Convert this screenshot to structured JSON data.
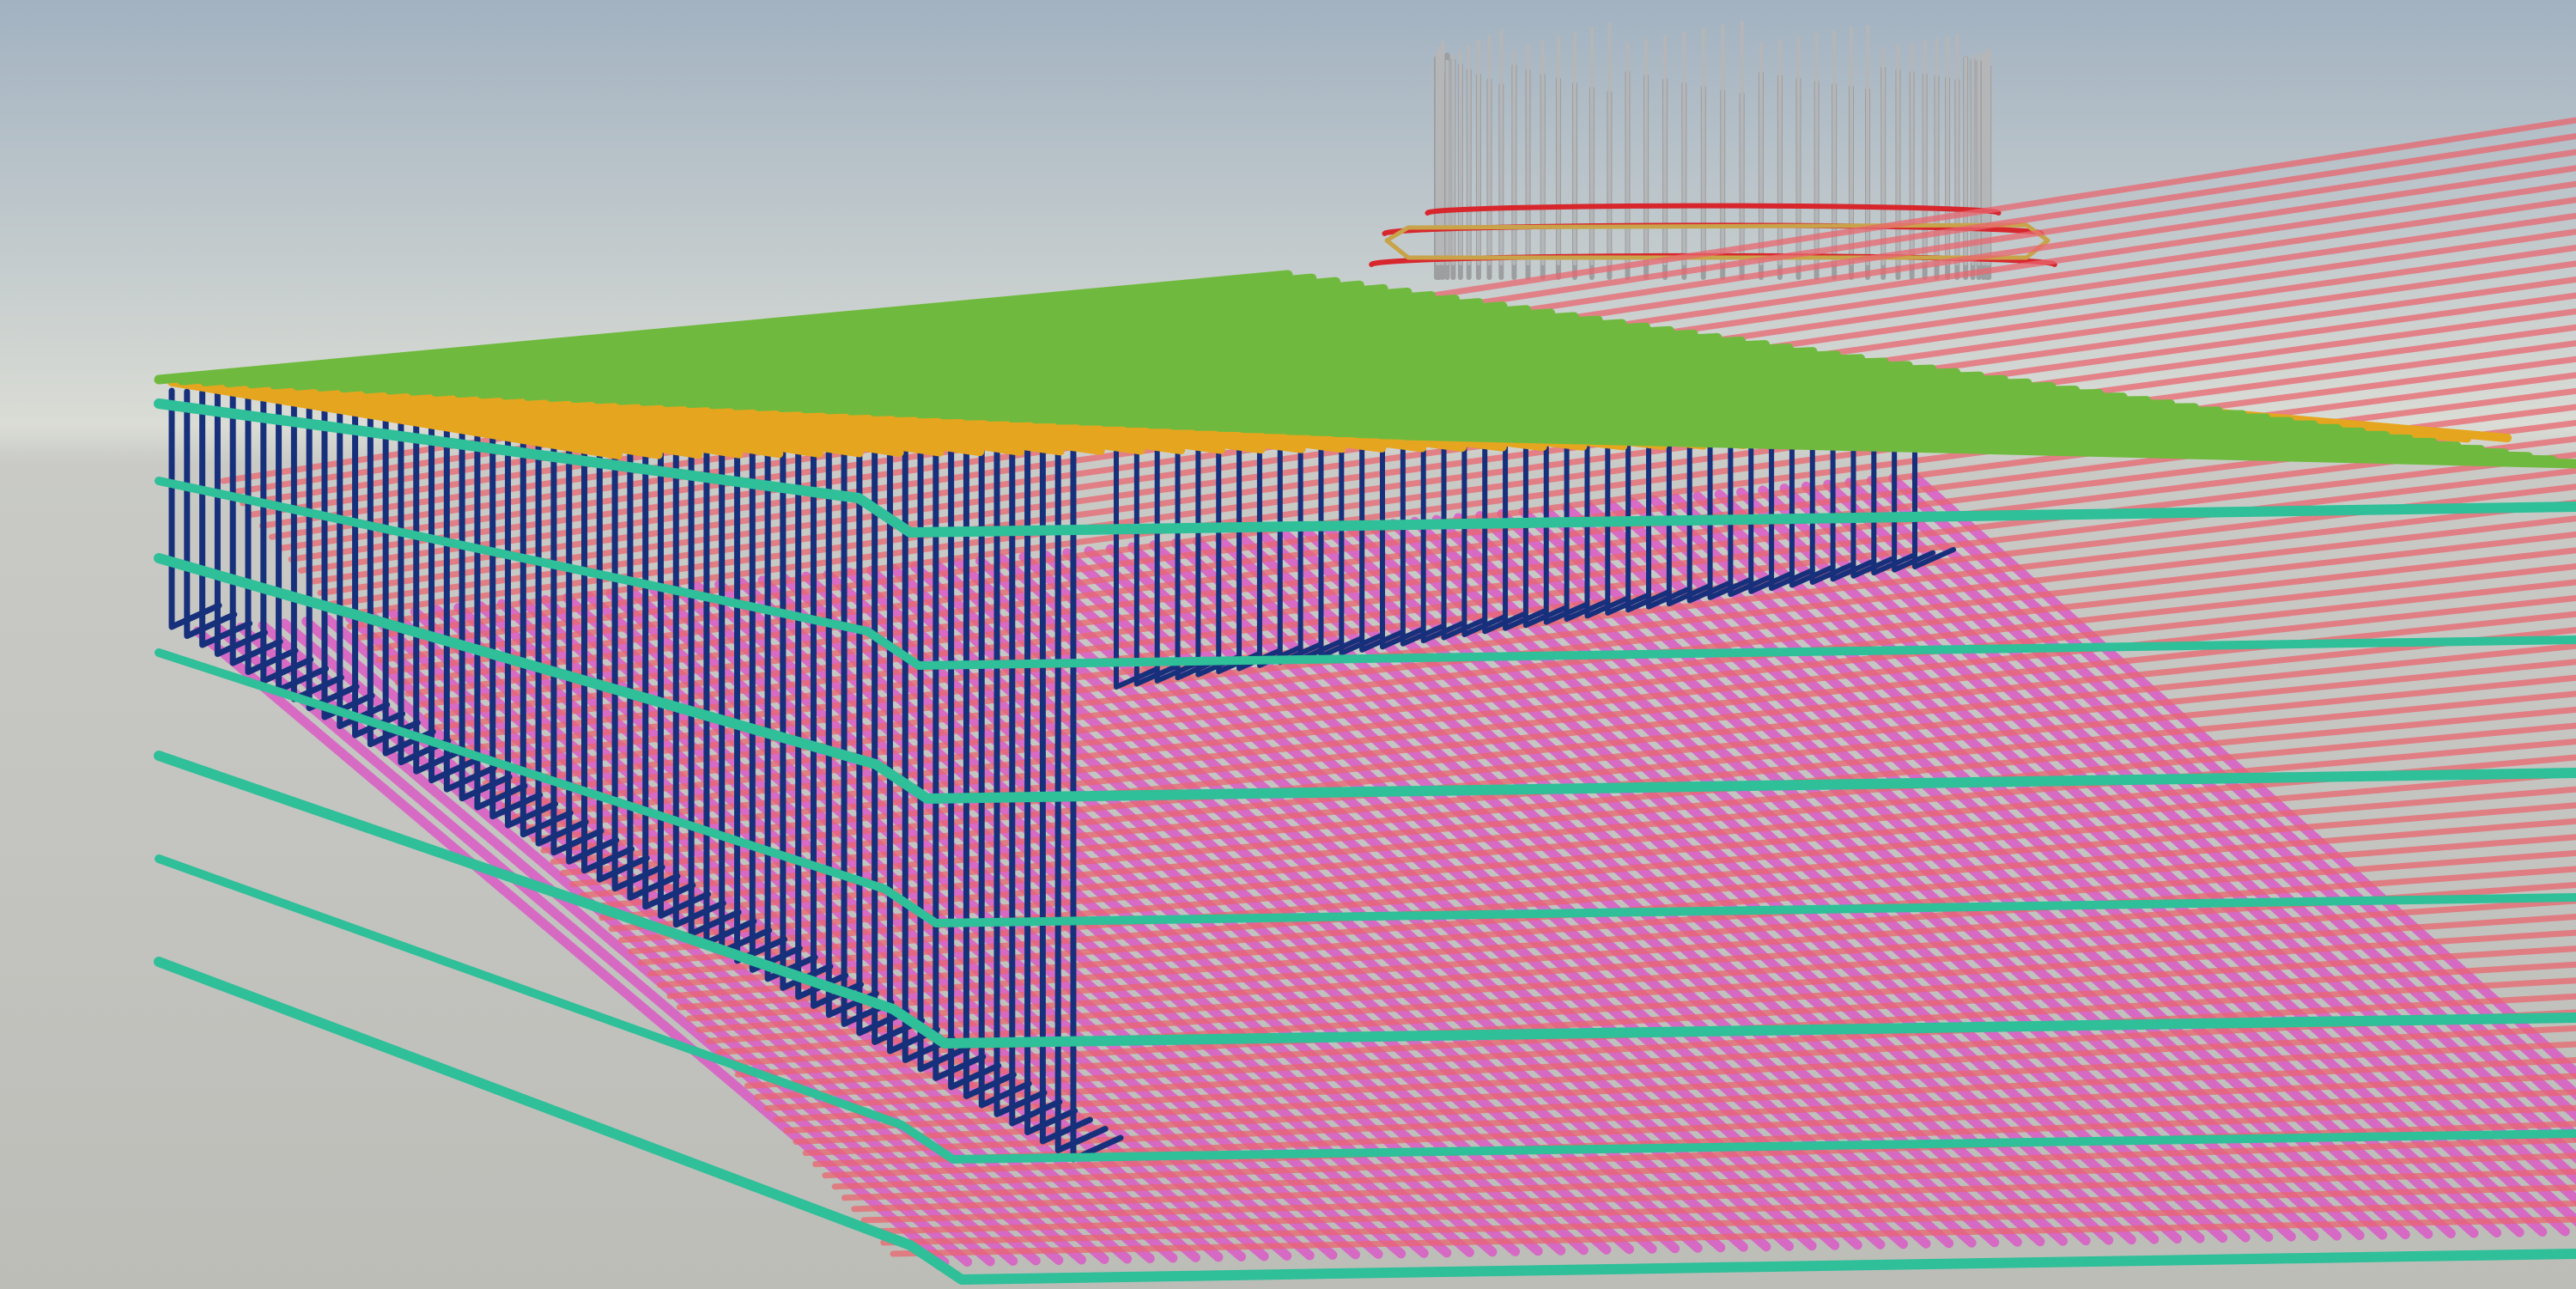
{
  "scene": {
    "subject": "reinforcement-cage-3d-render",
    "colors": {
      "sky_top": "#a4b3c2",
      "sky_horizon": "#dcded8",
      "ground": "#c3c3be",
      "top_bars_long": "#6fba3e",
      "top_bars_cross": "#e6a51e",
      "vertical_stirrups": "#17307c",
      "perimeter_bars": "#2fbf99",
      "bottom_mesh_a": "#d95bc4",
      "bottom_mesh_b": "#e8666f",
      "pier_bars": "#a7a9aa",
      "pier_hoops": "#d8262d"
    },
    "layers": [
      "top-mat-green",
      "top-mat-orange",
      "vertical-stirrups-blue",
      "perimeter-bars-teal",
      "bottom-mesh-magenta",
      "bottom-mesh-red",
      "pier-column-cage",
      "pier-hoops-red"
    ]
  }
}
